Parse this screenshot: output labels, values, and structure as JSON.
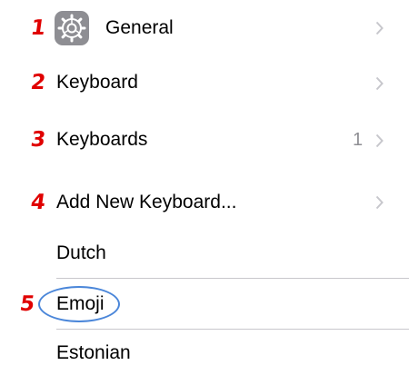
{
  "accent_colors": {
    "step_number": "#e00000",
    "highlight_ring": "#4a86d9",
    "chevron": "#c7c7cc",
    "detail_text": "#8e8e93",
    "settings_icon_bg": "#8e8e93"
  },
  "rows": {
    "general": {
      "step": "1",
      "label": "General",
      "icon": "settings-gear-icon"
    },
    "keyboard": {
      "step": "2",
      "label": "Keyboard"
    },
    "keyboards": {
      "step": "3",
      "label": "Keyboards",
      "detail": "1"
    },
    "add_new_keyboard": {
      "step": "4",
      "label": "Add New Keyboard..."
    },
    "languages": [
      {
        "label": "Dutch"
      },
      {
        "step": "5",
        "label": "Emoji",
        "highlighted": true
      },
      {
        "label": "Estonian"
      }
    ]
  }
}
